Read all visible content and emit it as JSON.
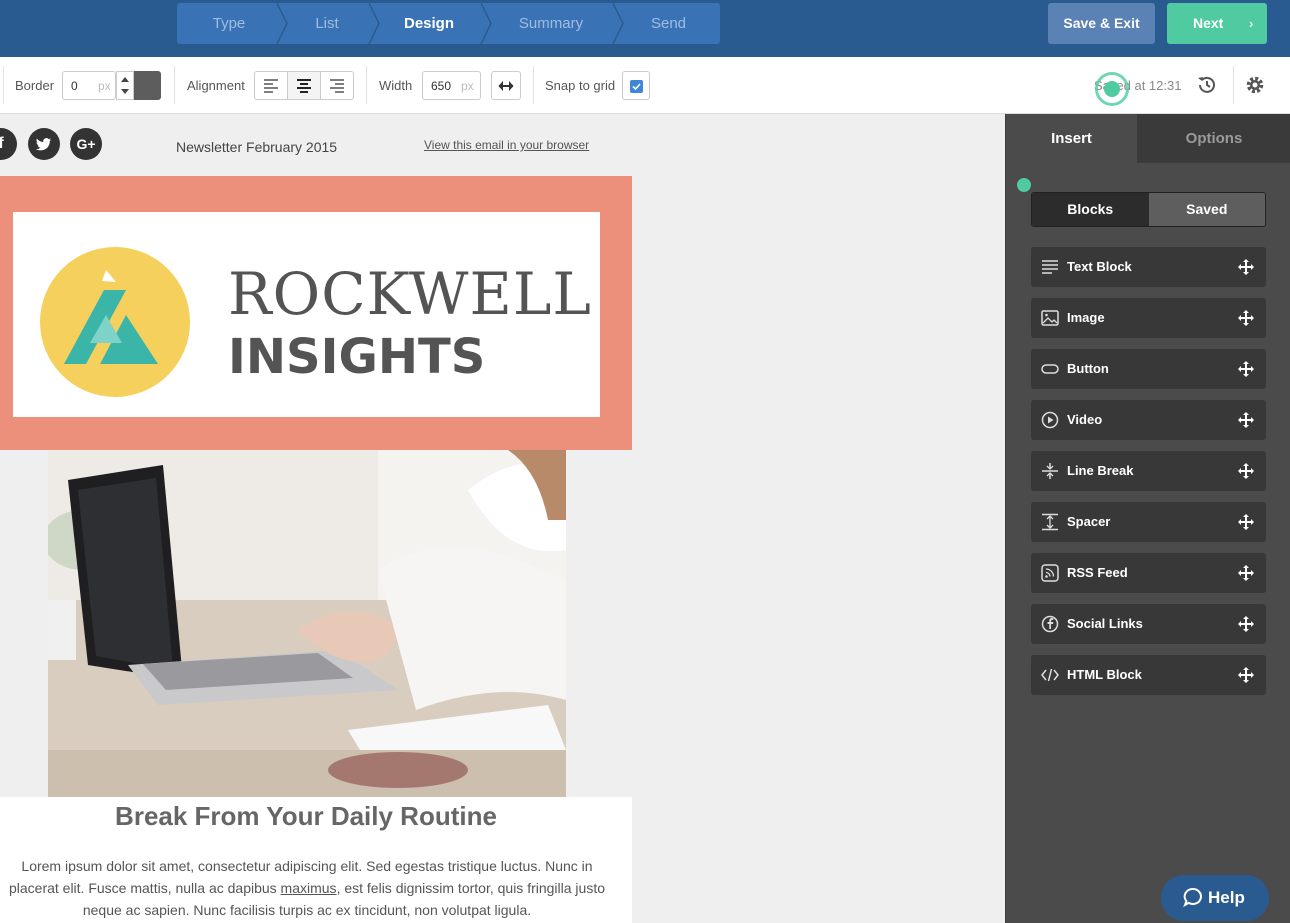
{
  "steps": [
    {
      "label": "Type"
    },
    {
      "label": "List"
    },
    {
      "label": "Design"
    },
    {
      "label": "Summary"
    },
    {
      "label": "Send"
    }
  ],
  "topbar": {
    "save_exit": "Save & Exit",
    "next": "Next",
    "next_chevron": "›"
  },
  "toolbar": {
    "border_label": "Border",
    "border_value": "0",
    "border_unit": "px",
    "alignment_label": "Alignment",
    "width_label": "Width",
    "width_value": "650",
    "width_unit": "px",
    "snap_label": "Snap to grid",
    "snap_checked": true,
    "saved_text": "Saved at 12:31"
  },
  "email": {
    "social": [
      "f",
      "t",
      "G+"
    ],
    "newsletter_title": "Newsletter February 2015",
    "view_link": "View this email in your browser",
    "logo_line1": "ROCKWELL",
    "logo_line2": "INSIGHTS",
    "article_title": "Break From Your Daily Routine",
    "article_before": "Lorem ipsum dolor sit amet, consectetur adipiscing elit. Sed egestas tristique luctus. Nunc in placerat elit. Fusce mattis, nulla ac dapibus ",
    "article_link": "maximus",
    "article_after": ", est felis dignissim tortor, quis fringilla justo neque ac sapien. Nunc facilisis turpis ac ex tincidunt, non volutpat ligula."
  },
  "panel": {
    "tab_insert": "Insert",
    "tab_options": "Options",
    "seg_blocks": "Blocks",
    "seg_saved": "Saved",
    "blocks": [
      {
        "label": "Text Block",
        "icon": "text-block-icon"
      },
      {
        "label": "Image",
        "icon": "image-icon"
      },
      {
        "label": "Button",
        "icon": "button-icon"
      },
      {
        "label": "Video",
        "icon": "video-icon"
      },
      {
        "label": "Line Break",
        "icon": "line-break-icon"
      },
      {
        "label": "Spacer",
        "icon": "spacer-icon"
      },
      {
        "label": "RSS Feed",
        "icon": "rss-icon"
      },
      {
        "label": "Social Links",
        "icon": "social-links-icon"
      },
      {
        "label": "HTML Block",
        "icon": "html-block-icon"
      }
    ]
  },
  "help": {
    "label": "Help"
  },
  "colors": {
    "topbar": "#2a5b90",
    "accent_green": "#4fcaa1",
    "header_block": "#ec907b",
    "logo_yellow": "#f5d05d",
    "logo_teal": "#3bb5a8"
  }
}
